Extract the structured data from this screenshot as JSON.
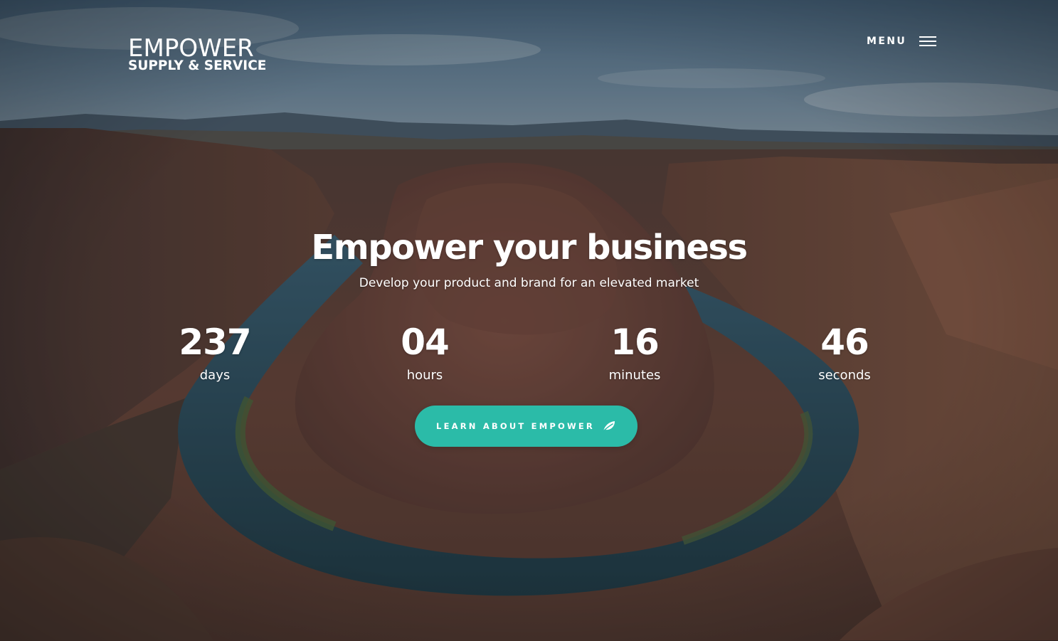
{
  "logo": {
    "line1": "EMPOWER",
    "line2": "SUPPLY & SERVICE"
  },
  "nav": {
    "menu_label": "MENU",
    "menu_icon": "hamburger-icon"
  },
  "hero": {
    "headline": "Empower your business",
    "subheadline": "Develop your product and brand for an elevated market"
  },
  "countdown": [
    {
      "value": "237",
      "label": "days"
    },
    {
      "value": "04",
      "label": "hours"
    },
    {
      "value": "16",
      "label": "minutes"
    },
    {
      "value": "46",
      "label": "seconds"
    }
  ],
  "cta": {
    "label": "LEARN ABOUT EMPOWER",
    "icon": "leaf-icon"
  },
  "colors": {
    "accent": "#2bbba8",
    "text": "#ffffff"
  },
  "background": {
    "image": "canyon-river-landscape"
  }
}
